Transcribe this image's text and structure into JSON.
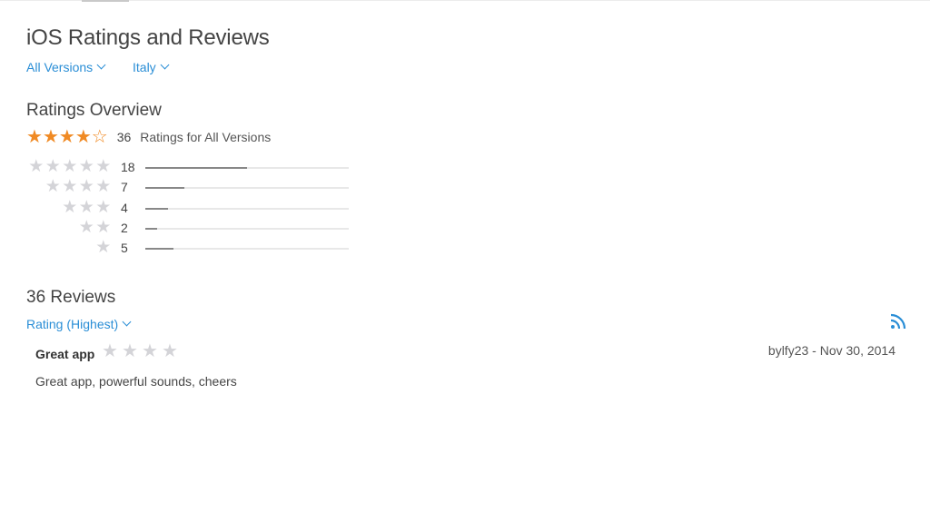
{
  "header": {
    "title": "iOS Ratings and Reviews",
    "filters": [
      {
        "label": "All Versions"
      },
      {
        "label": "Italy"
      }
    ]
  },
  "overview": {
    "title": "Ratings Overview",
    "average_stars": 4,
    "max_stars": 5,
    "count": "36",
    "count_label": "Ratings for All Versions",
    "histogram": [
      {
        "stars": 5,
        "count": "18",
        "fraction": 0.5
      },
      {
        "stars": 4,
        "count": "7",
        "fraction": 0.19
      },
      {
        "stars": 3,
        "count": "4",
        "fraction": 0.11
      },
      {
        "stars": 2,
        "count": "2",
        "fraction": 0.06
      },
      {
        "stars": 1,
        "count": "5",
        "fraction": 0.14
      }
    ]
  },
  "reviews": {
    "title": "36 Reviews",
    "sort_label": "Rating (Highest)",
    "items": [
      {
        "title": "Great app",
        "stars_shown": 4,
        "meta": "bylfy23 - Nov 30, 2014",
        "body": "Great app, powerful sounds, cheers"
      }
    ]
  },
  "colors": {
    "accent": "#2a8ed6",
    "star_rating": "#f08a24",
    "star_inactive": "#d4d4d8",
    "bar_fill": "#888888",
    "bar_track": "#e8e8e8"
  },
  "icons": {
    "filter_chevron": "chevron-down-icon",
    "rss": "rss-feed-icon",
    "star": "star-icon"
  }
}
